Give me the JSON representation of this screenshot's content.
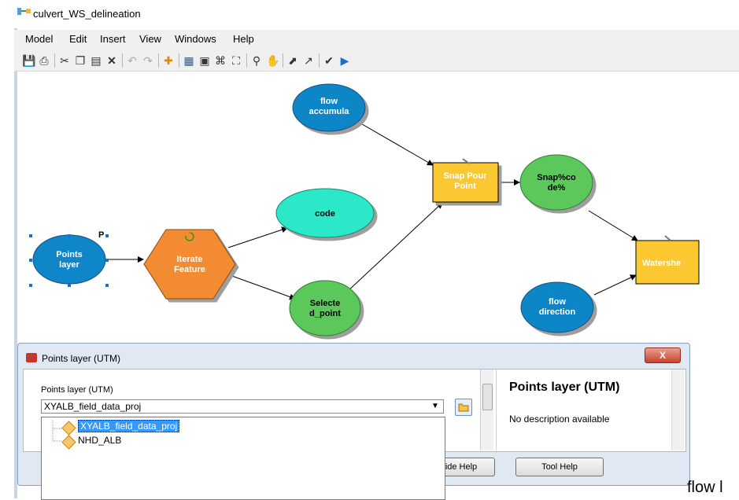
{
  "window": {
    "title": "culvert_WS_delineation"
  },
  "menu": [
    "Model",
    "Edit",
    "Insert",
    "View",
    "Windows",
    "Help"
  ],
  "toolbar_icons": [
    "save-icon",
    "print-icon",
    "cut-icon",
    "copy-icon",
    "paste-icon",
    "delete-icon",
    "undo-icon",
    "redo-icon",
    "add-data-icon",
    "auto-layout-icon",
    "full-extent-icon",
    "fit-icon",
    "zoom-extent-icon",
    "zoom-in-icon",
    "pan-icon",
    "select-icon",
    "connect-icon",
    "validate-icon",
    "run-icon"
  ],
  "model": {
    "nodes": {
      "points_layer": {
        "label1": "Points",
        "label2": "layer",
        "marker": "P"
      },
      "iterate_feature": {
        "label1": "Iterate",
        "label2": "Feature"
      },
      "code": {
        "label1": "code"
      },
      "selected_point": {
        "label1": "Selecte",
        "label2": "d_point"
      },
      "flow_accumula": {
        "label1": "flow",
        "label2": "accumula"
      },
      "snap_pour_point": {
        "label1": "Snap Pour",
        "label2": "Point"
      },
      "snap_code": {
        "label1": "Snap%co",
        "label2": "de%"
      },
      "watershed": {
        "label1": "Watershe"
      },
      "flow_direction": {
        "label1": "flow",
        "label2": "direction"
      }
    },
    "colors": {
      "variable_blue": "#0e86c8",
      "tool_orange": "#f28b30",
      "value_cyan": "#2ce8c8",
      "output_green": "#5cc85c",
      "tool_yellow": "#fcc832"
    }
  },
  "dialog": {
    "title": "Points layer (UTM)",
    "close_label": "X",
    "param_label": "Points layer (UTM)",
    "combo_value": "XYALB_field_data_proj",
    "description_title": "Points layer (UTM)",
    "description_text": "No description available",
    "hide_help_label": "ide Help",
    "tool_help_label": "Tool Help"
  },
  "dropdown_items": [
    {
      "label": "XYALB_field_data_proj",
      "selected": true
    },
    {
      "label": "NHD_ALB",
      "selected": false
    }
  ],
  "trailing_text": "flow l"
}
